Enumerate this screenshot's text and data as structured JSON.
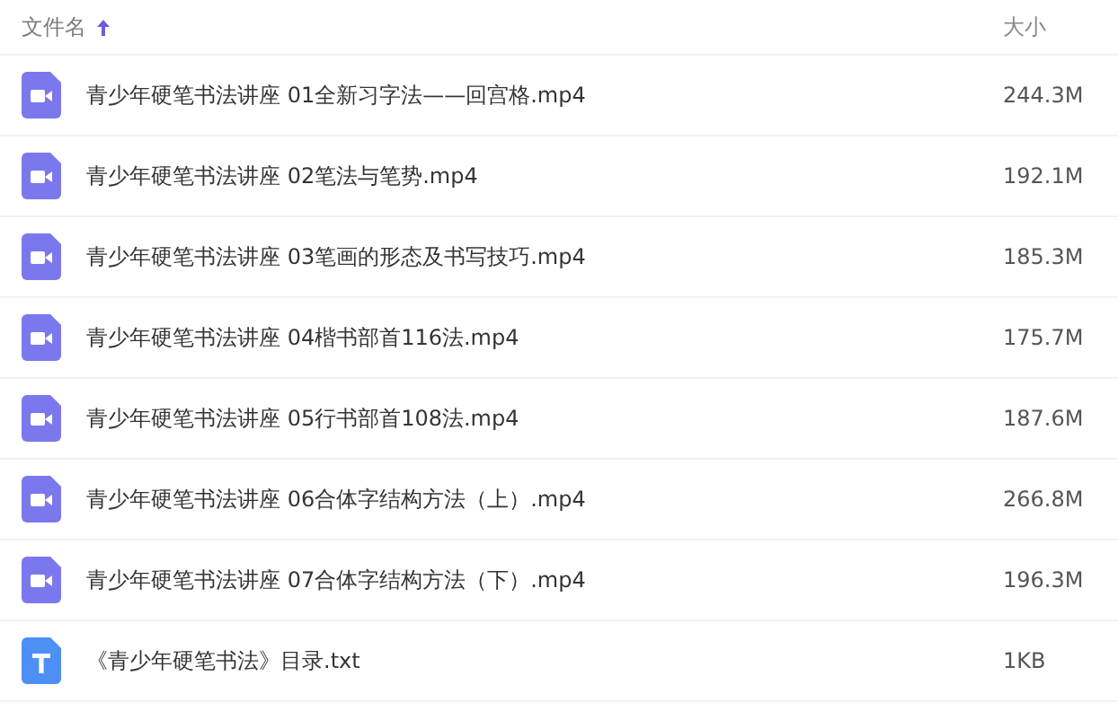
{
  "table": {
    "columns": [
      {
        "label": "文件名",
        "sorted": true
      },
      {
        "label": "大小",
        "sorted": false
      }
    ],
    "rows": [
      {
        "kind": "video",
        "name": "青少年硬笔书法讲座 01全新习字法——回宫格.mp4",
        "size": "244.3M"
      },
      {
        "kind": "video",
        "name": "青少年硬笔书法讲座 02笔法与笔势.mp4",
        "size": "192.1M"
      },
      {
        "kind": "video",
        "name": "青少年硬笔书法讲座 03笔画的形态及书写技巧.mp4",
        "size": "185.3M"
      },
      {
        "kind": "video",
        "name": "青少年硬笔书法讲座 04楷书部首116法.mp4",
        "size": "175.7M"
      },
      {
        "kind": "video",
        "name": "青少年硬笔书法讲座 05行书部首108法.mp4",
        "size": "187.6M"
      },
      {
        "kind": "video",
        "name": "青少年硬笔书法讲座 06合体字结构方法（上）.mp4",
        "size": "266.8M"
      },
      {
        "kind": "video",
        "name": "青少年硬笔书法讲座 07合体字结构方法（下）.mp4",
        "size": "196.3M"
      },
      {
        "kind": "text",
        "name": "《青少年硬笔书法》目录.txt",
        "size": "1KB"
      }
    ]
  }
}
